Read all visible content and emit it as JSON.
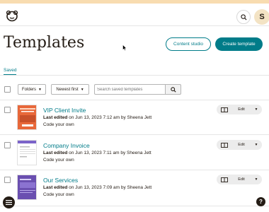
{
  "header": {
    "avatar_initial": "S"
  },
  "page": {
    "title": "Templates",
    "content_studio_label": "Content studio",
    "create_template_label": "Create template"
  },
  "tabs": [
    {
      "label": "Saved",
      "active": true
    }
  ],
  "filters": {
    "folders_label": "Folders",
    "sort_label": "Newest first",
    "search_placeholder": "Search saved templates"
  },
  "templates": [
    {
      "name": "VIP Client Invite",
      "meta_prefix": "Last edited",
      "meta_rest": "on Jun 13, 2023 7:12 am by Sheena Jett",
      "type": "Code your own",
      "edit_label": "Edit",
      "thumb_color": "#e8683a"
    },
    {
      "name": "Company Invoice",
      "meta_prefix": "Last edited",
      "meta_rest": "on Jun 13, 2023 7:11 am by Sheena Jett",
      "type": "Code your own",
      "edit_label": "Edit",
      "thumb_color": "#7b63c9"
    },
    {
      "name": "Our Services",
      "meta_prefix": "Last edited",
      "meta_rest": "on Jun 13, 2023 7:09 am by Sheena Jett",
      "type": "Code your own",
      "edit_label": "Edit",
      "thumb_color": "#6a4fb0"
    }
  ],
  "colors": {
    "accent": "#007c89",
    "text": "#241c15",
    "stripe": "#f8dcb0"
  },
  "icons": [
    "mailchimp-logo-icon",
    "search-icon",
    "preview-icon",
    "chevron-down-icon",
    "menu-icon",
    "help-icon"
  ]
}
